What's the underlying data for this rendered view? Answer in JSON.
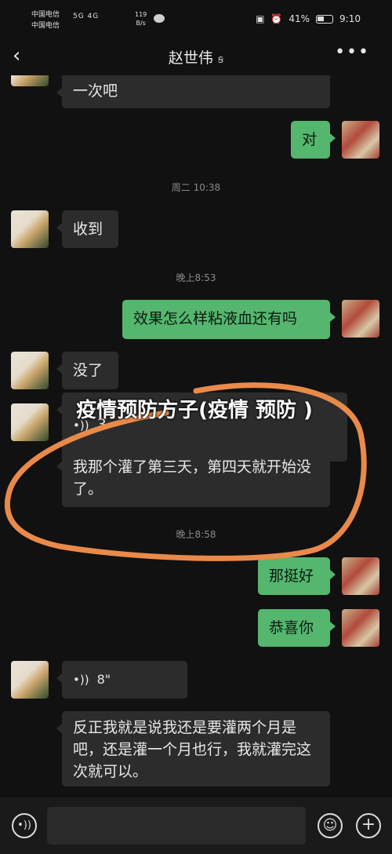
{
  "status_bar": {
    "carrier1": "中国电信",
    "carrier2": "中国电信",
    "network": "5G 4G",
    "speed_value": "119",
    "speed_unit": "B/s",
    "battery": "41%",
    "time": "9:10"
  },
  "header": {
    "title": "赵世伟",
    "back_icon": "chevron-left-icon",
    "more_icon": "more-dots-icon"
  },
  "messages": [
    {
      "side": "in",
      "text": "一次吧"
    },
    {
      "side": "out",
      "text": "对"
    },
    {
      "type": "time",
      "text": "周二 10:38"
    },
    {
      "side": "in",
      "text": "收到"
    },
    {
      "type": "time",
      "text": "晚上8:53"
    },
    {
      "side": "out",
      "text": "效果怎么样粘液血还有吗"
    },
    {
      "side": "in",
      "text": "没了"
    },
    {
      "side": "in",
      "type": "voice",
      "text": "3"
    },
    {
      "side": "in",
      "text": "我那个灌了第三天，第四天就开始没了。"
    },
    {
      "type": "time",
      "text": "晚上8:58"
    },
    {
      "side": "out",
      "text": "那挺好"
    },
    {
      "side": "out",
      "text": "恭喜你"
    },
    {
      "side": "in",
      "type": "voice",
      "text": "8\""
    },
    {
      "side": "in",
      "text": "反正我就是说我还是要灌两个月是吧，还是灌一个月也行，我就灌完这次就可以。"
    }
  ],
  "overlay": {
    "title": "疫情预防方子(疫情 预防 )",
    "ring_color": "#e98a4a"
  },
  "input_bar": {
    "voice_icon": "voice-input-icon",
    "emoji_icon": "emoji-icon",
    "add_icon": "plus-icon"
  },
  "colors": {
    "outgoing_bubble": "#55b66e",
    "incoming_bubble": "#2c2c2c",
    "background": "#111111"
  }
}
